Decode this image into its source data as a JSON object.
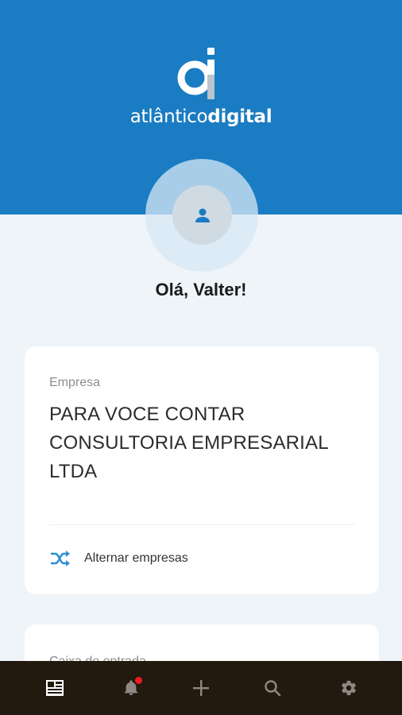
{
  "brand": {
    "name_light": "atlântico",
    "name_bold": "digital",
    "logo_icon": "ai-monogram-logo"
  },
  "profile": {
    "greeting": "Olá, Valter!",
    "avatar_icon": "person-icon"
  },
  "company_card": {
    "label": "Empresa",
    "company_name": "PARA VOCE CONTAR CONSULTORIA EMPRESARIAL LTDA",
    "switch_label": "Alternar empresas",
    "switch_icon": "shuffle-icon"
  },
  "inbox_card": {
    "label": "Caixa de entrada"
  },
  "bottom_nav": {
    "items": [
      {
        "name": "dashboard",
        "icon": "dashboard-icon",
        "active": true
      },
      {
        "name": "notifications",
        "icon": "bell-icon",
        "badge": true
      },
      {
        "name": "add",
        "icon": "plus-icon"
      },
      {
        "name": "search",
        "icon": "search-icon"
      },
      {
        "name": "settings",
        "icon": "gear-icon"
      }
    ]
  },
  "colors": {
    "primary": "#1a7cc2",
    "accent_icon": "#2a8fd6",
    "nav_bg": "#22190f",
    "badge": "#ee1d1d"
  }
}
